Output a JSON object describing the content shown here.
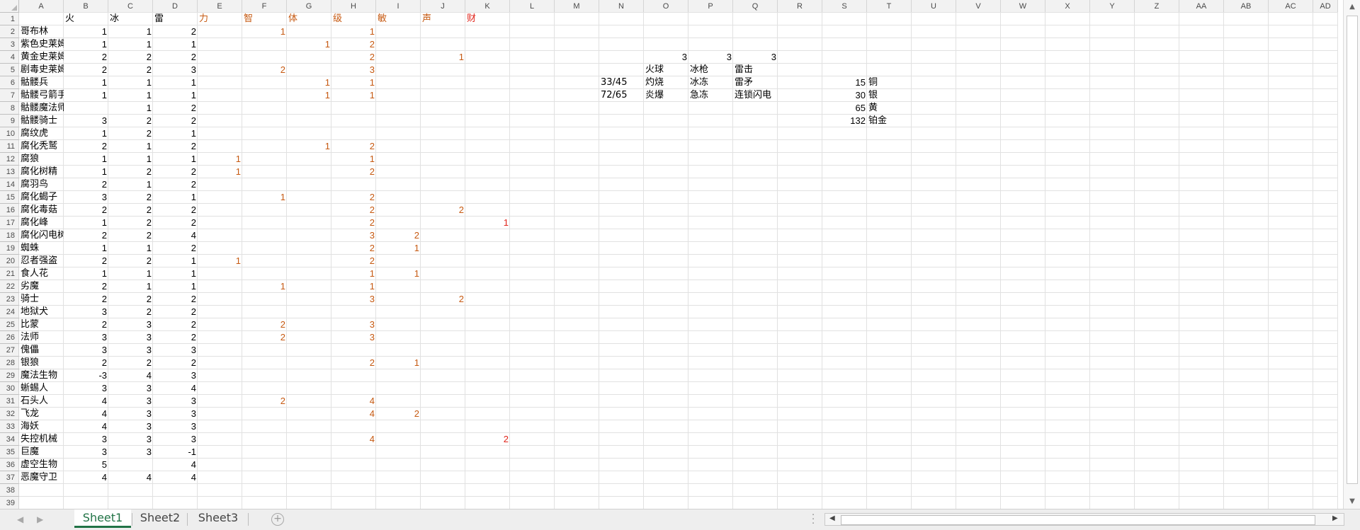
{
  "columns": [
    "A",
    "B",
    "C",
    "D",
    "E",
    "F",
    "G",
    "H",
    "I",
    "J",
    "K",
    "L",
    "M",
    "N",
    "O",
    "P",
    "Q",
    "R",
    "S",
    "T",
    "U",
    "V",
    "W",
    "X",
    "Y",
    "Z",
    "AA",
    "AB",
    "AC",
    "AD"
  ],
  "row_numbers": [
    "1",
    "2",
    "3",
    "4",
    "5",
    "6",
    "7",
    "8",
    "9",
    "10",
    "11",
    "12",
    "13",
    "14",
    "15",
    "16",
    "17",
    "18",
    "19",
    "20",
    "21",
    "22",
    "23",
    "24",
    "25",
    "26",
    "27",
    "28",
    "29",
    "30",
    "31",
    "32",
    "33",
    "34",
    "35",
    "36",
    "37",
    "38",
    "39"
  ],
  "header_row": [
    "",
    "火",
    "冰",
    "雷",
    "力",
    "智",
    "体",
    "级",
    "敏",
    "声",
    "财"
  ],
  "table_rows": [
    [
      "哥布林",
      "1",
      "1",
      "2",
      "",
      "1",
      "",
      "1",
      "",
      "",
      ""
    ],
    [
      "紫色史莱姆",
      "1",
      "1",
      "1",
      "",
      "",
      "1",
      "2",
      "",
      "",
      ""
    ],
    [
      "黄金史莱姆",
      "2",
      "2",
      "2",
      "",
      "",
      "",
      "2",
      "",
      "1",
      ""
    ],
    [
      "剧毒史莱姆",
      "2",
      "2",
      "3",
      "",
      "2",
      "",
      "3",
      "",
      "",
      ""
    ],
    [
      "骷髅兵",
      "1",
      "1",
      "1",
      "",
      "",
      "1",
      "1",
      "",
      "",
      ""
    ],
    [
      "骷髅弓箭手",
      "1",
      "1",
      "1",
      "",
      "",
      "1",
      "1",
      "",
      "",
      ""
    ],
    [
      "骷髅魔法师",
      "",
      "1",
      "2",
      "",
      "",
      "",
      "",
      "",
      "",
      ""
    ],
    [
      "骷髅骑士",
      "3",
      "2",
      "2",
      "",
      "",
      "",
      "",
      "",
      "",
      ""
    ],
    [
      "腐纹虎",
      "1",
      "2",
      "1",
      "",
      "",
      "",
      "",
      "",
      "",
      ""
    ],
    [
      "腐化秃鹫",
      "2",
      "1",
      "2",
      "",
      "",
      "1",
      "2",
      "",
      "",
      ""
    ],
    [
      "腐狼",
      "1",
      "1",
      "1",
      "1",
      "",
      "",
      "1",
      "",
      "",
      ""
    ],
    [
      "腐化树精",
      "1",
      "2",
      "2",
      "1",
      "",
      "",
      "2",
      "",
      "",
      ""
    ],
    [
      "腐羽鸟",
      "2",
      "1",
      "2",
      "",
      "",
      "",
      "",
      "",
      "",
      ""
    ],
    [
      "腐化蝎子",
      "3",
      "2",
      "1",
      "",
      "1",
      "",
      "2",
      "",
      "",
      ""
    ],
    [
      "腐化毒菇",
      "2",
      "2",
      "2",
      "",
      "",
      "",
      "2",
      "",
      "2",
      ""
    ],
    [
      "腐化峰",
      "1",
      "2",
      "2",
      "",
      "",
      "",
      "2",
      "",
      "",
      "1"
    ],
    [
      "腐化闪电树",
      "2",
      "2",
      "4",
      "",
      "",
      "",
      "3",
      "2",
      "",
      ""
    ],
    [
      "蜘蛛",
      "1",
      "1",
      "2",
      "",
      "",
      "",
      "2",
      "1",
      "",
      ""
    ],
    [
      "忍者强盗",
      "2",
      "2",
      "1",
      "1",
      "",
      "",
      "2",
      "",
      "",
      ""
    ],
    [
      "食人花",
      "1",
      "1",
      "1",
      "",
      "",
      "",
      "1",
      "1",
      "",
      ""
    ],
    [
      "劣魔",
      "2",
      "1",
      "1",
      "",
      "1",
      "",
      "1",
      "",
      "",
      ""
    ],
    [
      "骑士",
      "2",
      "2",
      "2",
      "",
      "",
      "",
      "3",
      "",
      "2",
      ""
    ],
    [
      "地狱犬",
      "3",
      "2",
      "2",
      "",
      "",
      "",
      "",
      "",
      "",
      ""
    ],
    [
      "比蒙",
      "2",
      "3",
      "2",
      "",
      "2",
      "",
      "3",
      "",
      "",
      ""
    ],
    [
      "法师",
      "3",
      "3",
      "2",
      "",
      "2",
      "",
      "3",
      "",
      "",
      ""
    ],
    [
      "傀儡",
      "3",
      "3",
      "3",
      "",
      "",
      "",
      "",
      "",
      "",
      ""
    ],
    [
      "银狼",
      "2",
      "2",
      "2",
      "",
      "",
      "",
      "2",
      "1",
      "",
      ""
    ],
    [
      "魔法生物",
      "-3",
      "4",
      "3",
      "",
      "",
      "",
      "",
      "",
      "",
      ""
    ],
    [
      "蜥蜴人",
      "3",
      "3",
      "4",
      "",
      "",
      "",
      "",
      "",
      "",
      ""
    ],
    [
      "石头人",
      "4",
      "3",
      "3",
      "",
      "2",
      "",
      "4",
      "",
      "",
      ""
    ],
    [
      "飞龙",
      "4",
      "3",
      "3",
      "",
      "",
      "",
      "4",
      "2",
      "",
      ""
    ],
    [
      "海妖",
      "4",
      "3",
      "3",
      "",
      "",
      "",
      "",
      "",
      "",
      ""
    ],
    [
      "失控机械",
      "3",
      "3",
      "3",
      "",
      "",
      "",
      "4",
      "",
      "",
      "2"
    ],
    [
      "巨魔",
      "3",
      "3",
      "-1",
      "",
      "",
      "",
      "",
      "",
      "",
      ""
    ],
    [
      "虚空生物",
      "5",
      "",
      "4",
      "",
      "",
      "",
      "",
      "",
      "",
      ""
    ],
    [
      "恶魔守卫",
      "4",
      "4",
      "4",
      "",
      "",
      "",
      "",
      "",
      "",
      ""
    ]
  ],
  "side_block": {
    "o4": "3",
    "p4": "3",
    "q4": "3",
    "o5": "火球",
    "p5": "冰枪",
    "q5": "雷击",
    "n6": "33/45",
    "o6": "灼烧",
    "p6": "冰冻",
    "q6": "雷矛",
    "n7": "72/65",
    "o7": "炎爆",
    "p7": "急冻",
    "q7": "连锁闪电",
    "currency": [
      {
        "value": "15",
        "name": "铜"
      },
      {
        "value": "30",
        "name": "银"
      },
      {
        "value": "65",
        "name": "黄"
      },
      {
        "value": "132",
        "name": "铂金"
      }
    ]
  },
  "sheet_tabs": [
    "Sheet1",
    "Sheet2",
    "Sheet3"
  ],
  "active_tab": "Sheet1",
  "icons": {
    "first_sheet": "triangle-left",
    "last_sheet": "triangle-right",
    "add_sheet": "plus-circle",
    "options": "vertical-dots",
    "scroll_left": "triangle-left",
    "scroll_right": "triangle-right",
    "scroll_up": "triangle-up",
    "scroll_down": "triangle-down"
  },
  "colors": {
    "orange_values": "#c65911",
    "red_values": "#e0241b",
    "active_tab": "#217346",
    "header_bg": "#f2f2f2",
    "gridline": "#e1e1e1"
  }
}
